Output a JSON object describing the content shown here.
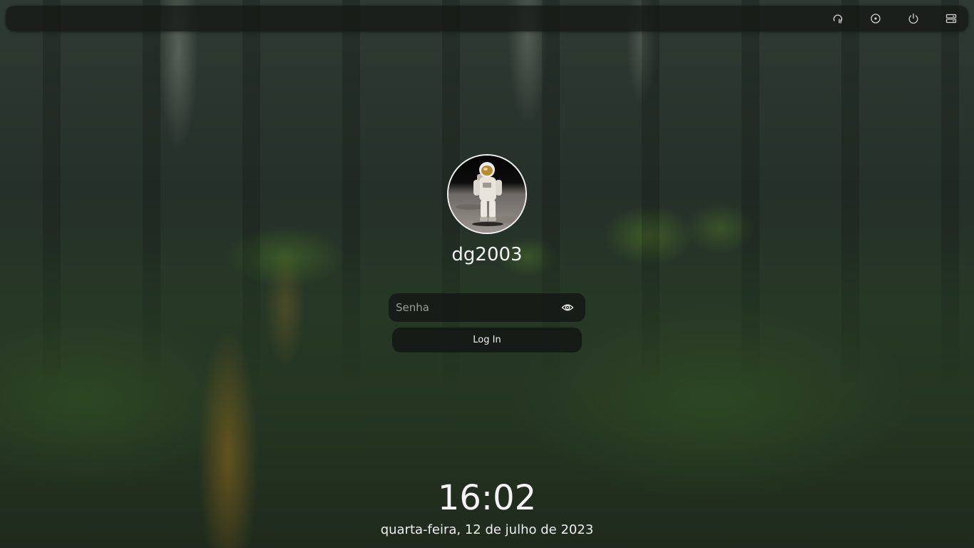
{
  "top_bar": {
    "icons": [
      "accessibility-icon",
      "screen-keyboard-icon",
      "power-icon",
      "session-menu-icon"
    ]
  },
  "user": {
    "name": "dg2003",
    "avatar": "astronaut-avatar"
  },
  "password": {
    "placeholder": "Senha",
    "value": ""
  },
  "login_button": {
    "label": "Log In"
  },
  "clock": {
    "time": "16:02",
    "date": "quarta-feira, 12 de julho de 2023"
  },
  "colors": {
    "text": "#f2f2f2",
    "panel": "#141815"
  }
}
